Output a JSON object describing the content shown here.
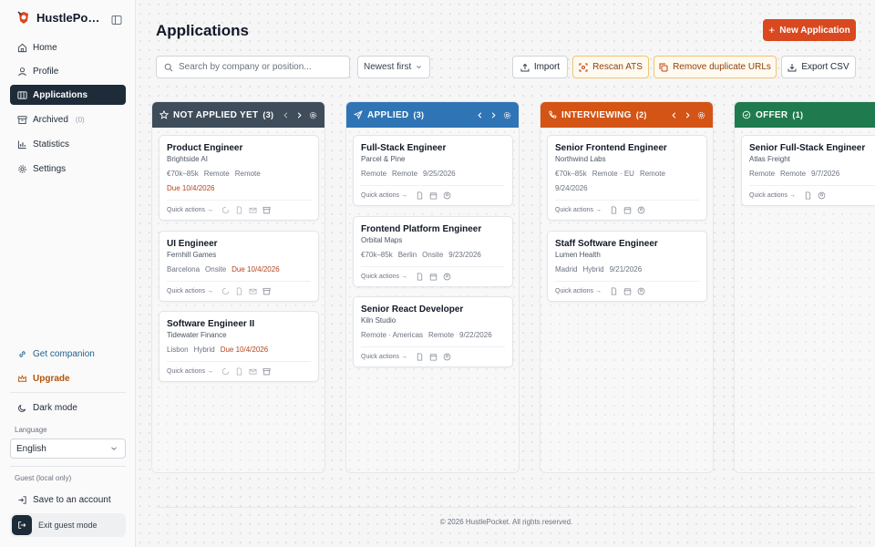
{
  "app": {
    "name": "HustlePocket"
  },
  "sidebar": {
    "nav": [
      {
        "label": "Home",
        "icon": "home-icon"
      },
      {
        "label": "Profile",
        "icon": "user-icon"
      },
      {
        "label": "Applications",
        "icon": "columns-icon",
        "active": true
      },
      {
        "label": "Archived",
        "icon": "archive-icon",
        "count": "(0)"
      },
      {
        "label": "Statistics",
        "icon": "chart-icon"
      },
      {
        "label": "Settings",
        "icon": "gear-icon"
      }
    ],
    "companion": "Get companion",
    "upgrade": "Upgrade",
    "dark_mode": "Dark mode",
    "language_label": "Language",
    "language_value": "English",
    "guest_label": "Guest (local only)",
    "save_account": "Save to an account",
    "exit_guest": "Exit guest mode"
  },
  "main": {
    "title": "Applications",
    "new_button": "New Application",
    "search_placeholder": "Search by company or position...",
    "sort_value": "Newest first",
    "toolbar": {
      "import": "Import",
      "rescan": "Rescan ATS",
      "remove_dupes": "Remove duplicate URLs",
      "export": "Export CSV"
    },
    "quick_actions": "Quick actions →"
  },
  "columns": [
    {
      "title": "NOT APPLIED YET",
      "count": "(3)",
      "color": "#3f4c5a",
      "cards": [
        {
          "title": "Product Engineer",
          "company": "Brightside AI",
          "meta": [
            "€70k–85k",
            "Remote",
            "Remote"
          ],
          "due": "Due 10/4/2026"
        },
        {
          "title": "UI Engineer",
          "company": "Fernhill Games",
          "meta": [
            "Barcelona",
            "Onsite"
          ],
          "due": "Due 10/4/2026"
        },
        {
          "title": "Software Engineer II",
          "company": "Tidewater Finance",
          "meta": [
            "Lisbon",
            "Hybrid"
          ],
          "due": "Due 10/4/2026"
        }
      ]
    },
    {
      "title": "APPLIED",
      "count": "(3)",
      "color": "#2f74b5",
      "cards": [
        {
          "title": "Full-Stack Engineer",
          "company": "Parcel & Pine",
          "meta": [
            "Remote",
            "Remote",
            "9/25/2026"
          ]
        },
        {
          "title": "Frontend Platform Engineer",
          "company": "Orbital Maps",
          "meta": [
            "€70k–85k",
            "Berlin",
            "Onsite",
            "9/23/2026"
          ]
        },
        {
          "title": "Senior React Developer",
          "company": "Kiln Studio",
          "meta": [
            "Remote · Americas",
            "Remote",
            "9/22/2026"
          ]
        }
      ]
    },
    {
      "title": "INTERVIEWING",
      "count": "(2)",
      "color": "#d35415",
      "cards": [
        {
          "title": "Senior Frontend Engineer",
          "company": "Northwind Labs",
          "meta": [
            "€70k–85k",
            "Remote · EU",
            "Remote",
            "9/24/2026"
          ]
        },
        {
          "title": "Staff Software Engineer",
          "company": "Lumen Health",
          "meta": [
            "Madrid",
            "Hybrid",
            "9/21/2026"
          ]
        }
      ]
    },
    {
      "title": "OFFER",
      "count": "(1)",
      "color": "#1f7a4d",
      "cards": [
        {
          "title": "Senior Full-Stack Engineer",
          "company": "Atlas Freight",
          "meta": [
            "Remote",
            "Remote",
            "9/7/2026"
          ]
        }
      ]
    }
  ],
  "footer": "© 2026 HustlePocket. All rights reserved."
}
